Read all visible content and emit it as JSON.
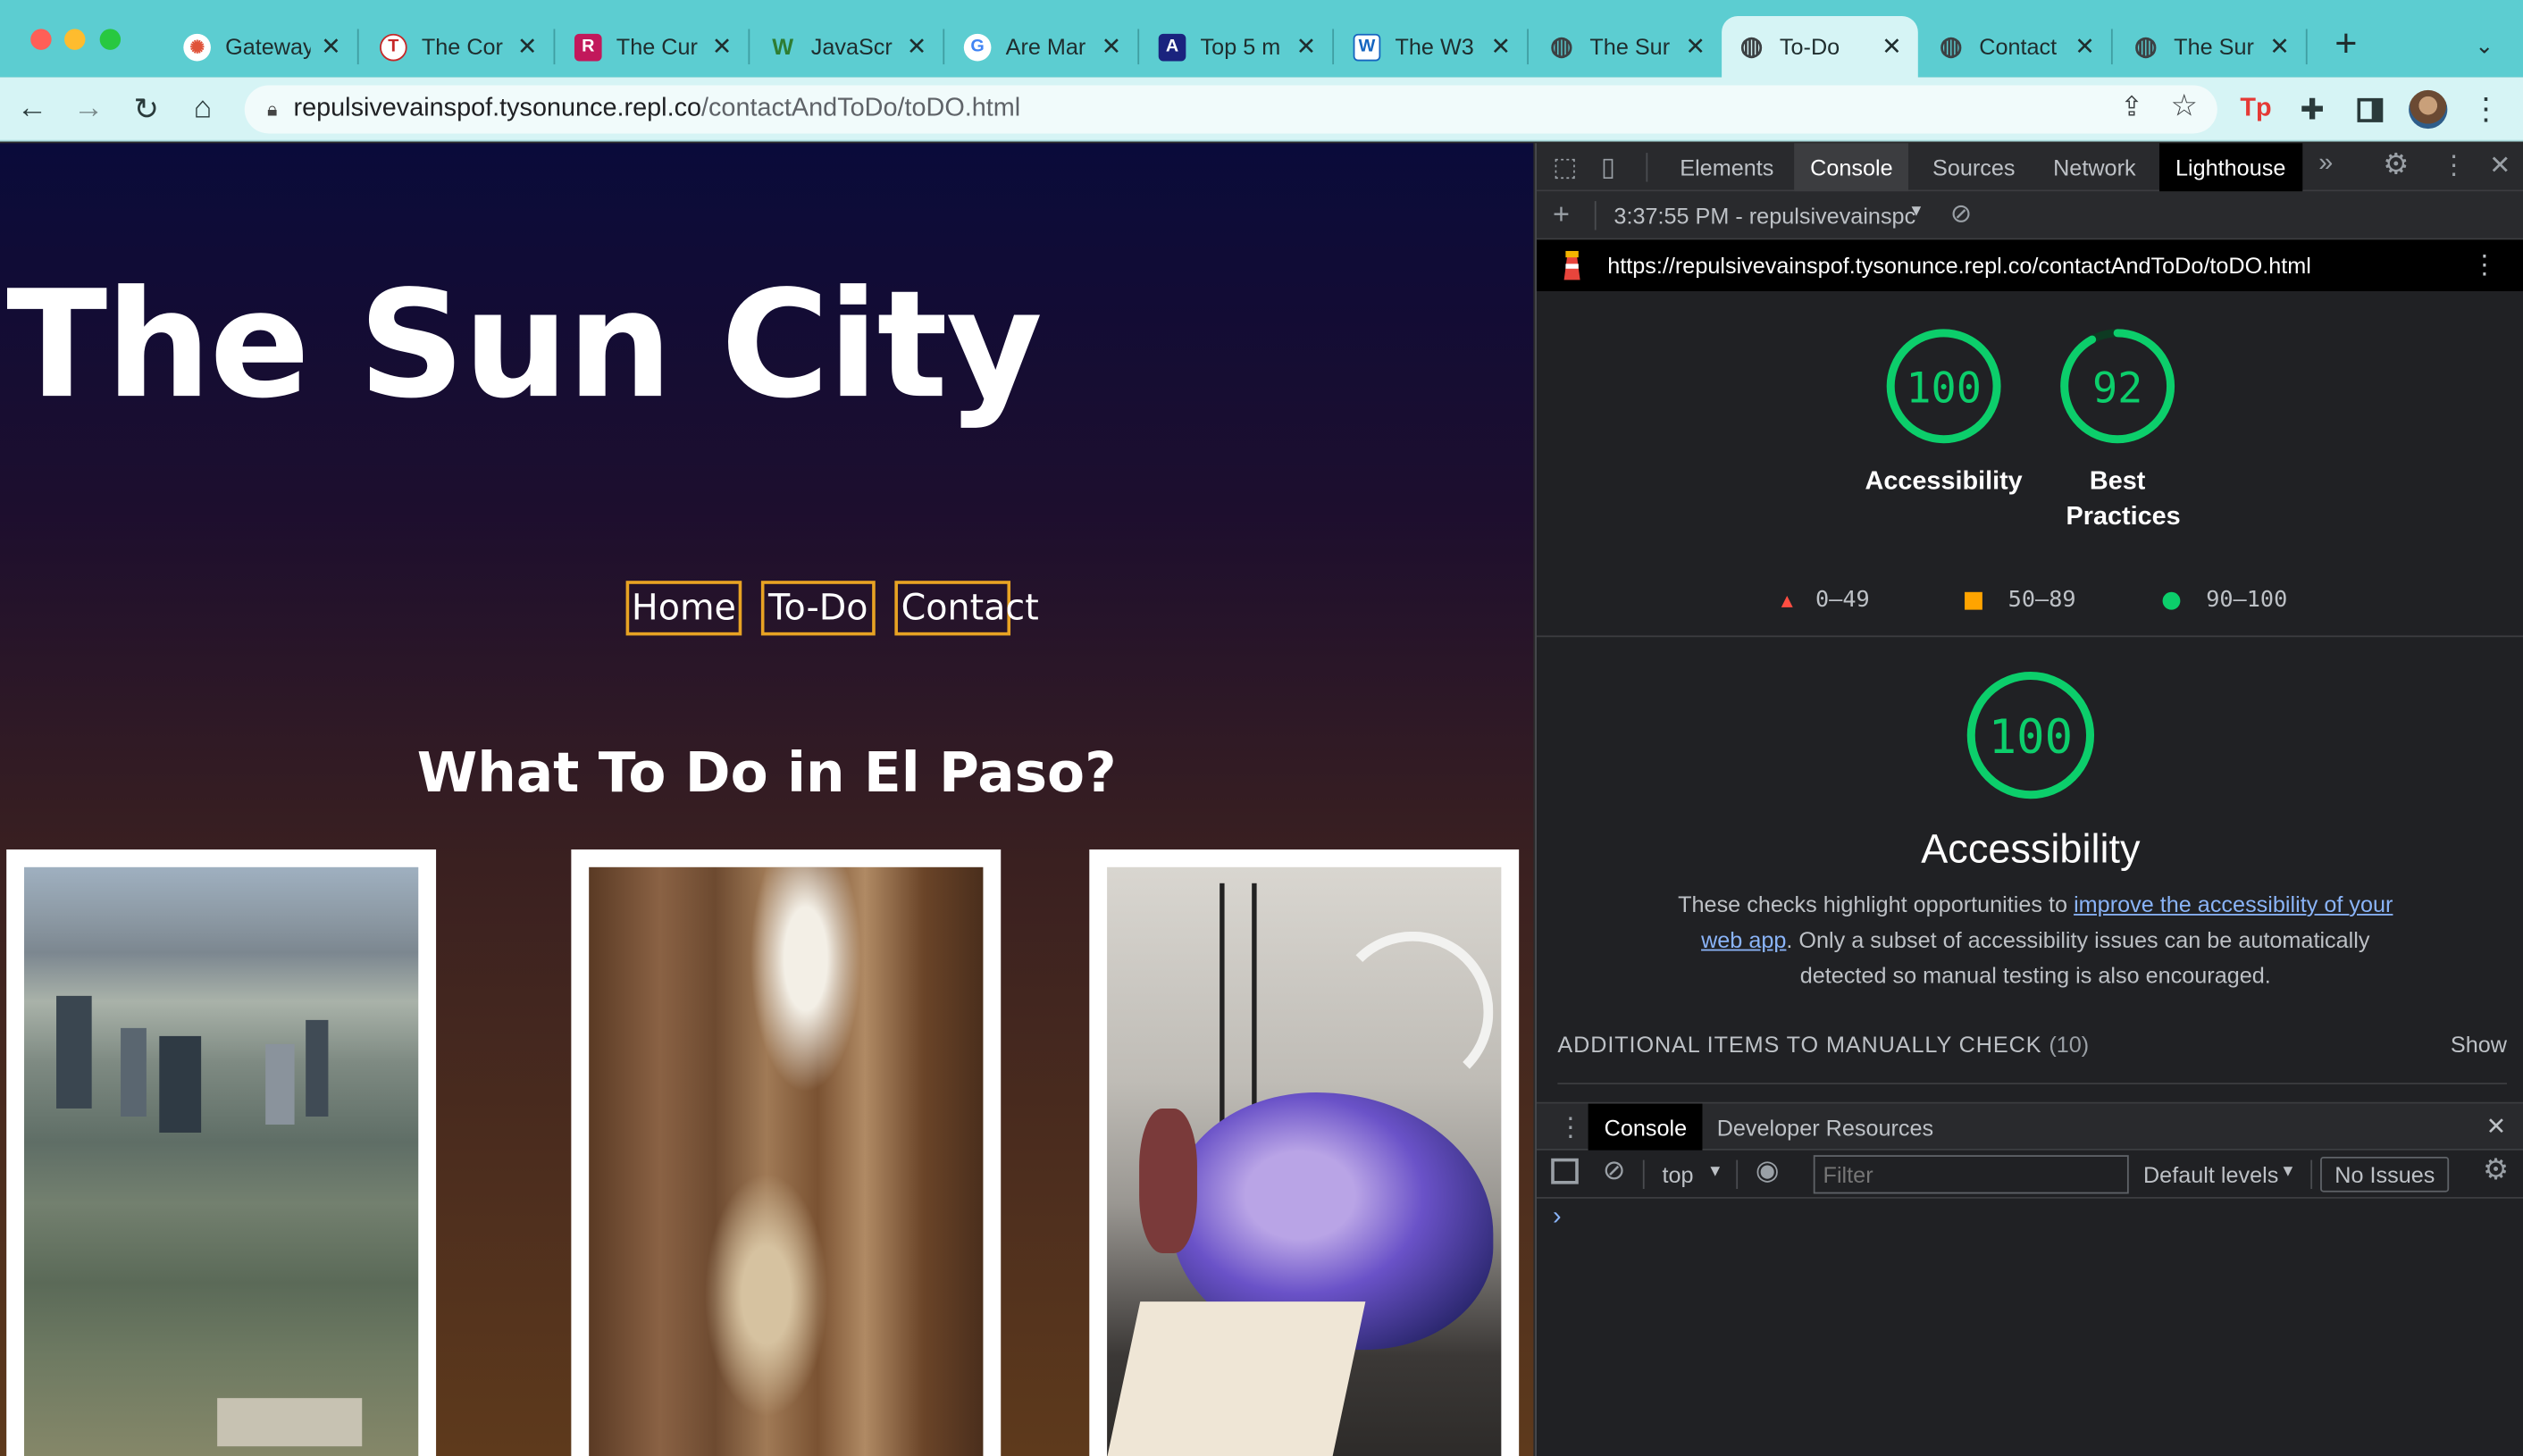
{
  "browser": {
    "tabs": [
      {
        "title": "Gateway",
        "favicon_color": "#e0533a",
        "fav_glyph": "✺"
      },
      {
        "title": "The Cor",
        "favicon_color": "#c62828",
        "fav_glyph": "T"
      },
      {
        "title": "The Cur",
        "favicon_color": "#c2185b",
        "fav_glyph": "R"
      },
      {
        "title": "JavaScr",
        "favicon_color": "#3aa757",
        "fav_glyph": "W"
      },
      {
        "title": "Are Mar",
        "favicon_color": "#4285f4",
        "fav_glyph": "G"
      },
      {
        "title": "Top 5 m",
        "favicon_color": "#1a237e",
        "fav_glyph": "A"
      },
      {
        "title": "The W3",
        "favicon_color": "#1565c0",
        "fav_glyph": "W"
      },
      {
        "title": "The Sur",
        "favicon_color": "#3c4043",
        "fav_glyph": "◍"
      },
      {
        "title": "To-Do",
        "favicon_color": "#3c4043",
        "fav_glyph": "◍",
        "active": true
      },
      {
        "title": "Contact",
        "favicon_color": "#3c4043",
        "fav_glyph": "◍"
      },
      {
        "title": "The Sur",
        "favicon_color": "#3c4043",
        "fav_glyph": "◍"
      }
    ],
    "url_host": "repulsivevainspof.tysonunce.repl.co",
    "url_path": "/contactAndToDo/toDO.html"
  },
  "page": {
    "title": "The Sun City",
    "nav": [
      "Home",
      "To-Do",
      "Contact"
    ],
    "section_heading": "What To Do in El Paso?"
  },
  "devtools": {
    "tabs": [
      "Elements",
      "Console",
      "Sources",
      "Network",
      "Lighthouse"
    ],
    "selected_tab": "Console",
    "session": "3:37:55 PM - repulsivevainspc",
    "report_url": "https://repulsivevainspof.tysonunce.repl.co/contactAndToDo/toDO.html",
    "scores": [
      {
        "value": 100,
        "label": "Accessibility",
        "fraction": 1.0
      },
      {
        "value": 92,
        "label": "Best Practices",
        "fraction": 0.92
      }
    ],
    "legend": [
      "0–49",
      "50–89",
      "90–100"
    ],
    "colors": {
      "fail": "#ff4e42",
      "average": "#ffa400",
      "pass": "#0cce6b"
    },
    "category": {
      "value": 100,
      "title": "Accessibility",
      "desc_before": "These checks highlight opportunities to ",
      "desc_link": "improve the accessibility of your web app",
      "desc_after": ". Only a subset of accessibility issues can be automatically detected so manual testing is also encouraged."
    },
    "manual_check": "ADDITIONAL ITEMS TO MANUALLY CHECK",
    "manual_count": "(10)",
    "show_label": "Show",
    "drawer_tabs": [
      "Console",
      "Developer Resources"
    ],
    "context": "top",
    "filter_placeholder": "Filter",
    "levels": "Default levels",
    "issues": "No Issues",
    "prompt": "›"
  }
}
